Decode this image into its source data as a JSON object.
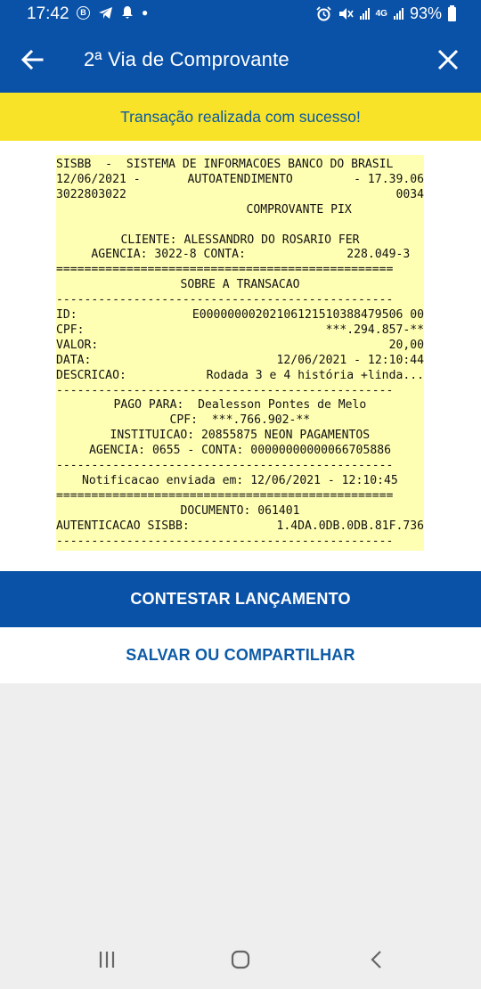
{
  "status_bar": {
    "time": "17:42",
    "icons_left": [
      "b-circle-icon",
      "telegram-icon",
      "notification-icon",
      "dot-icon"
    ],
    "network": "4G",
    "battery": "93%"
  },
  "header": {
    "title": "2ª Via de Comprovante",
    "back_icon": "arrow-left-icon",
    "close_icon": "close-icon"
  },
  "banner": {
    "text": "Transação realizada com sucesso!"
  },
  "receipt": {
    "lines": [
      {
        "left": "SISBB  -  SISTEMA DE INFORMACOES BANCO DO BRASIL"
      },
      {
        "left": "12/06/2021 -",
        "center": "AUTOATENDIMENTO",
        "right": "- 17.39.06"
      },
      {
        "left": "3022803022",
        "right": "0034"
      },
      {
        "center": "COMPROVANTE PIX",
        "shift": 66
      },
      {},
      {
        "center": "CLIENTE: ALESSANDRO DO ROSARIO FER"
      },
      {
        "left": "     AGENCIA: 3022-8 CONTA:",
        "right": "228.049-3  "
      },
      {
        "left": "================================================"
      },
      {
        "center": "SOBRE A TRANSACAO"
      },
      {
        "left": "------------------------------------------------"
      },
      {
        "left": "ID:",
        "right": "E00000000202106121510388479506 00"
      },
      {
        "left": "CPF:",
        "right": "***.294.857-**"
      },
      {
        "left": "VALOR:",
        "right": "20,00"
      },
      {
        "left": "DATA:",
        "right": "12/06/2021 - 12:10:44"
      },
      {
        "left": "DESCRICAO:",
        "right": "Rodada 3 e 4 história +linda..."
      },
      {
        "left": "------------------------------------------------"
      },
      {
        "center": "PAGO PARA:  Dealesson Pontes de Melo"
      },
      {
        "center": "CPF:  ***.766.902-**"
      },
      {
        "center": "INSTITUICAO: 20855875 NEON PAGAMENTOS"
      },
      {
        "center": "AGENCIA: 0655 - CONTA: 00000000000066705886"
      },
      {
        "left": "------------------------------------------------"
      },
      {
        "center": "Notificacao enviada em: 12/06/2021 - 12:10:45"
      },
      {
        "left": "================================================"
      },
      {
        "center": "DOCUMENTO: 061401"
      },
      {
        "left": "AUTENTICACAO SISBB:",
        "right": "1.4DA.0DB.0DB.81F.736"
      },
      {
        "left": "------------------------------------------------"
      }
    ]
  },
  "actions": {
    "contest_label": "CONTESTAR LANÇAMENTO",
    "save_label": "SALVAR OU COMPARTILHAR"
  },
  "colors": {
    "primary_blue": "#0a52a8",
    "banner_yellow": "#f8e328",
    "receipt_yellow": "#ffffb4",
    "link_blue": "#0c5aa6"
  },
  "nav_bar": {
    "icons": [
      "recents-icon",
      "home-icon",
      "back-icon"
    ]
  }
}
